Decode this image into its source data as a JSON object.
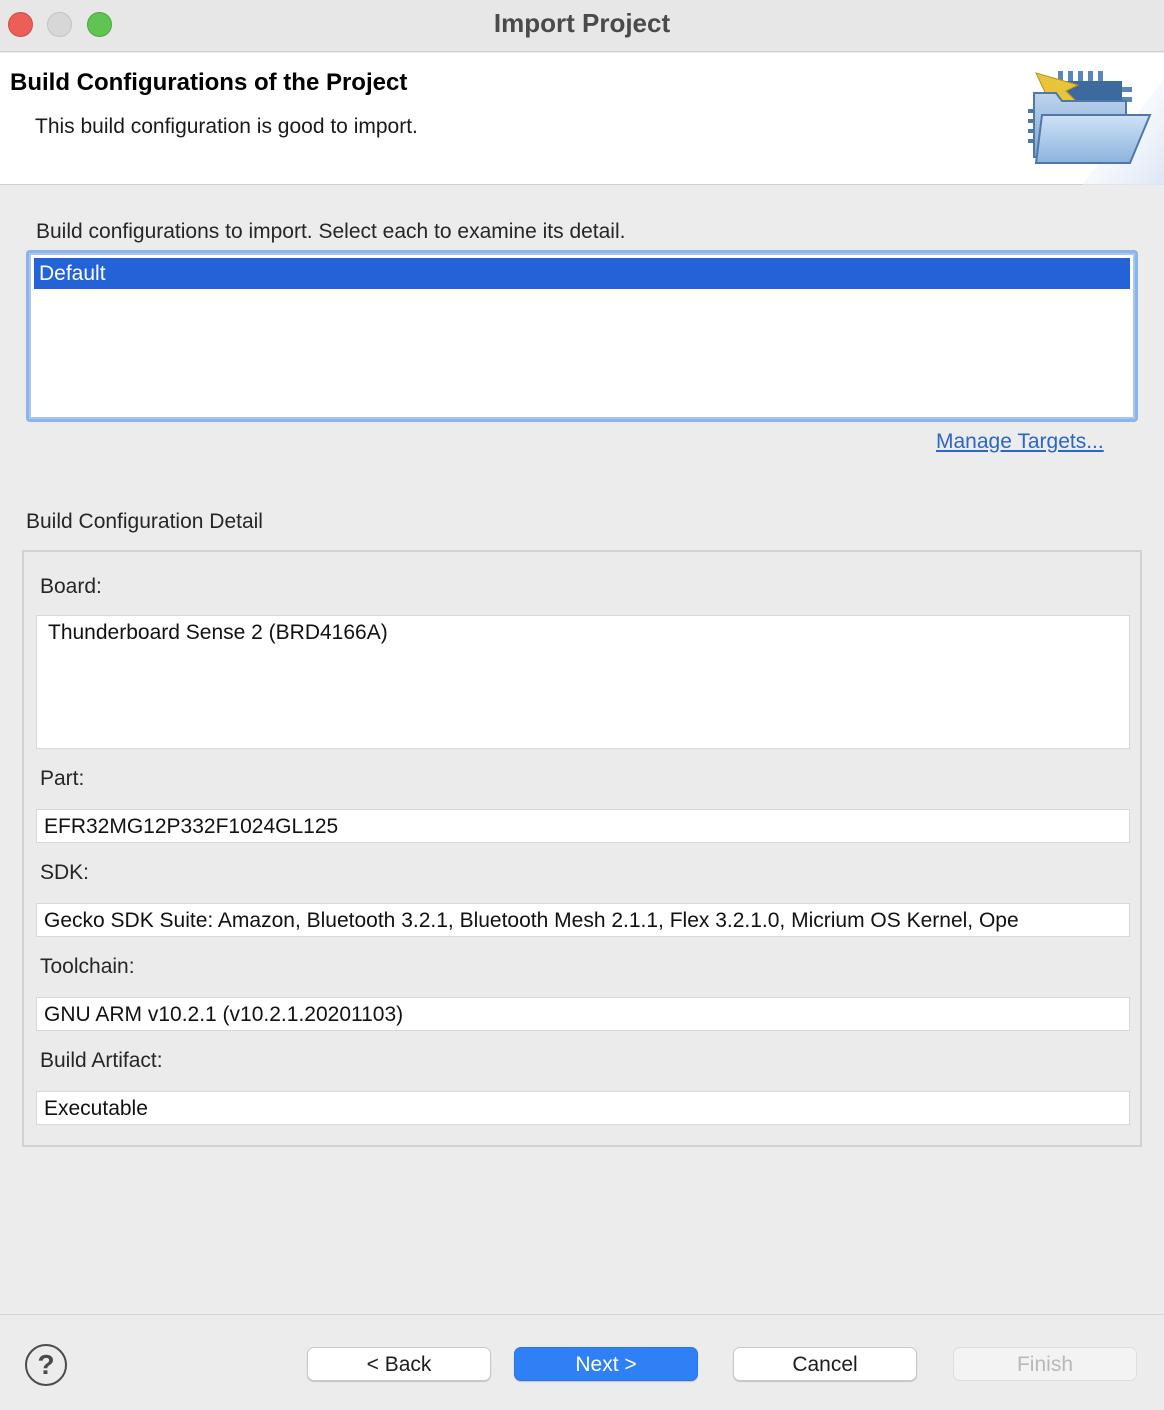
{
  "window": {
    "title": "Import Project"
  },
  "banner": {
    "title": "Build Configurations of the Project",
    "description": "This build configuration is good to import.",
    "icon": "folder-import-icon"
  },
  "configurations": {
    "label": "Build configurations to import. Select each to examine its detail.",
    "items": [
      "Default"
    ],
    "selected": "Default",
    "manage_link": "Manage Targets..."
  },
  "detail": {
    "label": "Build Configuration Detail",
    "board_label": "Board:",
    "board_value": "Thunderboard Sense 2 (BRD4166A)",
    "part_label": "Part:",
    "part_value": "EFR32MG12P332F1024GL125",
    "sdk_label": "SDK:",
    "sdk_value": "Gecko SDK Suite: Amazon, Bluetooth 3.2.1, Bluetooth Mesh 2.1.1, Flex 3.2.1.0, Micrium OS Kernel, Ope",
    "toolchain_label": "Toolchain:",
    "toolchain_value": "GNU ARM v10.2.1 (v10.2.1.20201103)",
    "artifact_label": "Build Artifact:",
    "artifact_value": "Executable"
  },
  "footer": {
    "help_icon": "help-icon",
    "help_glyph": "?",
    "back": "< Back",
    "next": "Next >",
    "cancel": "Cancel",
    "finish": "Finish"
  },
  "colors": {
    "selection": "#2463d7",
    "primary_button": "#2f7ff5",
    "link": "#2a66c8"
  }
}
